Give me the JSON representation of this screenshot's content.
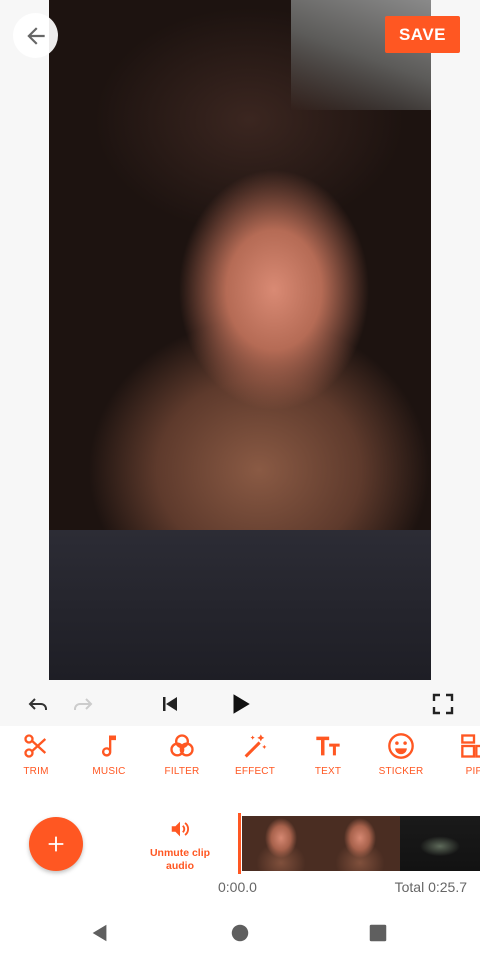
{
  "header": {
    "save_label": "SAVE"
  },
  "tools": [
    {
      "label": "TRIM",
      "icon": "scissors-icon"
    },
    {
      "label": "MUSIC",
      "icon": "music-note-icon"
    },
    {
      "label": "FILTER",
      "icon": "filter-circles-icon"
    },
    {
      "label": "EFFECT",
      "icon": "magic-wand-icon"
    },
    {
      "label": "TEXT",
      "icon": "text-tt-icon"
    },
    {
      "label": "STICKER",
      "icon": "smiley-icon"
    },
    {
      "label": "PIP",
      "icon": "pip-icon"
    }
  ],
  "timeline": {
    "unmute_label": "Unmute clip audio",
    "time_start": "0:00.0",
    "time_total": "Total 0:25.7"
  },
  "colors": {
    "accent": "#ff5722",
    "icon_gray": "#333333",
    "disabled_gray": "#cccccc"
  }
}
